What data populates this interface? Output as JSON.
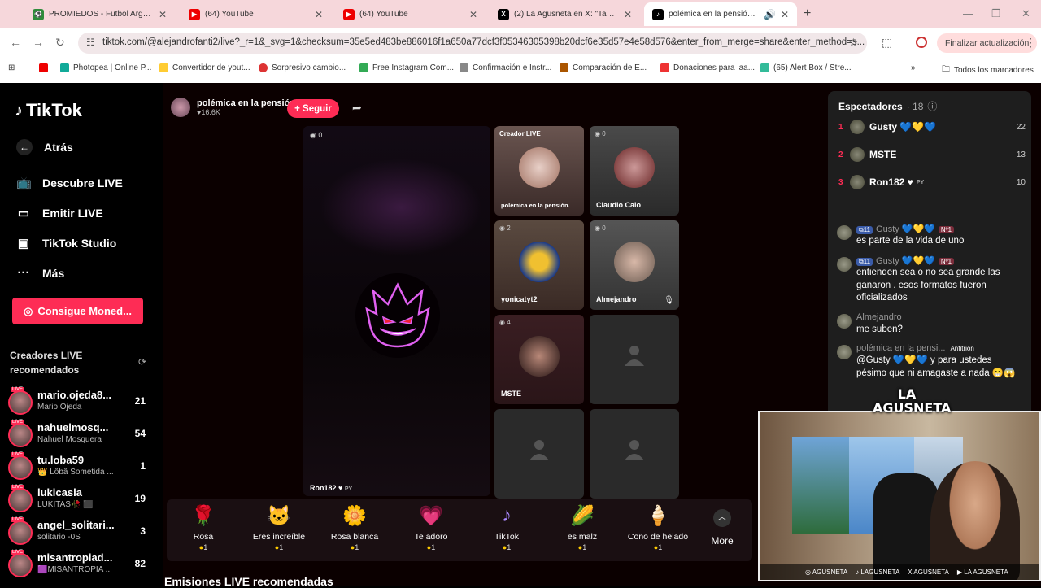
{
  "browser": {
    "tabs": [
      {
        "title": "PROMIEDOS - Futbol Argentino",
        "icon": "promiedos-icon",
        "color": "#2e8b3a"
      },
      {
        "title": "(64) YouTube",
        "icon": "youtube-icon",
        "color": "#e00"
      },
      {
        "title": "(64) YouTube",
        "icon": "youtube-icon",
        "color": "#e00"
      },
      {
        "title": "(2) La Agusneta en X: \"Tan mal",
        "icon": "x-icon",
        "color": "#000"
      },
      {
        "title": "polémica en la pensión. (@",
        "icon": "tiktok-icon",
        "color": "#000"
      }
    ],
    "url": "tiktok.com/@alejandrofanti2/live?_r=1&_svg=1&checksum=35e5ed483be886016f1a650a77dcf3f05346305398b20dcf6e35d57e4e58d576&enter_from_merge=share&enter_method=s...",
    "update_label": "Finalizar actualización",
    "bookmarks": [
      {
        "label": "",
        "color": "#e00"
      },
      {
        "label": "Photopea | Online P...",
        "color": "#1a9"
      },
      {
        "label": "Convertidor de yout...",
        "color": "#fc3"
      },
      {
        "label": "Sorpresivo cambio...",
        "color": "#d33"
      },
      {
        "label": "Free Instagram Com...",
        "color": "#3a5"
      },
      {
        "label": "Confirmación e Instr...",
        "color": "#888"
      },
      {
        "label": "Comparación de E...",
        "color": "#a50"
      },
      {
        "label": "Donaciones para laa...",
        "color": "#e33"
      },
      {
        "label": "(65) Alert Box / Stre...",
        "color": "#3b9"
      }
    ],
    "all_bookmarks": "Todos los marcadores"
  },
  "sidebar": {
    "logo": "TikTok",
    "back": "Atrás",
    "nav": [
      {
        "label": "Descubre LIVE",
        "icon": "live-tv-icon"
      },
      {
        "label": "Emitir LIVE",
        "icon": "camera-icon"
      },
      {
        "label": "TikTok Studio",
        "icon": "studio-icon"
      },
      {
        "label": "Más",
        "icon": "more-icon"
      }
    ],
    "coins_button": "Consigue Moned...",
    "recommended_title": "Creadores LIVE recomendados",
    "creators": [
      {
        "user": "mario.ojeda8...",
        "name": "Mario Ojeda",
        "count": "21"
      },
      {
        "user": "nahuelmosq...",
        "name": "Nahuel Mosquera",
        "count": "54"
      },
      {
        "user": "tu.loba59",
        "name": "👑 Lôbâ Sometida ...",
        "count": "1"
      },
      {
        "user": "lukicasla",
        "name": "LUKITAS🥀 ⬛",
        "count": "19"
      },
      {
        "user": "angel_solitari...",
        "name": "solitario -0S",
        "count": "3"
      },
      {
        "user": "misantropiad...",
        "name": "🟪MISANTROPIA ...",
        "count": "82"
      }
    ]
  },
  "host": {
    "name": "polémica en la pensión.",
    "likes": "♥16.6K",
    "follow": "+ Seguir"
  },
  "stage": {
    "count": "0",
    "name": "Ron182 ♥"
  },
  "grid": [
    {
      "tag": "Creador LIVE",
      "name": "polémica en la pensión.",
      "count": ""
    },
    {
      "tag": "",
      "name": "Claudio Caio",
      "count": "0"
    },
    {
      "tag": "",
      "name": "yonicatyt2",
      "count": "2"
    },
    {
      "tag": "",
      "name": "Almejandro",
      "count": "0"
    },
    {
      "tag": "",
      "name": "MSTE",
      "count": "4"
    }
  ],
  "gifts": [
    {
      "name": "Rosa",
      "price": "1",
      "emoji": "🌹"
    },
    {
      "name": "Eres increíble",
      "price": "1",
      "emoji": "🐱"
    },
    {
      "name": "Rosa blanca",
      "price": "1",
      "emoji": "🌼"
    },
    {
      "name": "Te adoro",
      "price": "1",
      "emoji": "💗"
    },
    {
      "name": "TikTok",
      "price": "1",
      "emoji": "♪"
    },
    {
      "name": "es malz",
      "price": "1",
      "emoji": "🌽"
    },
    {
      "name": "Cono de helado",
      "price": "1",
      "emoji": "🍦"
    }
  ],
  "more_label": "More",
  "section_title": "Emisiones LIVE recomendadas",
  "spectators": {
    "title": "Espectadores",
    "count": "· 18",
    "list": [
      {
        "rank": "1",
        "name": "Gusty 💙💛💙",
        "score": "22"
      },
      {
        "rank": "2",
        "name": "MSTE",
        "score": "13"
      },
      {
        "rank": "3",
        "name": "Ron182 ♥",
        "score": "10"
      }
    ]
  },
  "chat": [
    {
      "level": "11",
      "user": "Gusty 💙💛💙",
      "fan": "Nº1",
      "msg": "es parte de la vida de uno"
    },
    {
      "level": "11",
      "user": "Gusty 💙💛💙",
      "fan": "Nº1",
      "msg": "entienden sea o no sea grande las ganaron . esos formatos fueron oficializados"
    },
    {
      "level": "",
      "user": "Almejandro",
      "fan": "",
      "msg": "me suben?"
    },
    {
      "level": "",
      "user": "polémica en la pensi...",
      "fan": "",
      "host": "Anfitrión",
      "msg": "@Gusty 💙💛💙 y para ustedes pésimo que ni amagaste a nada 😁😱"
    }
  ],
  "webcam": {
    "logo": "LA AGUSNETA",
    "socials": [
      "AGUSNETA",
      "LAGUSNETA",
      "AGUSNETA",
      "LA AGUSNETA"
    ]
  }
}
